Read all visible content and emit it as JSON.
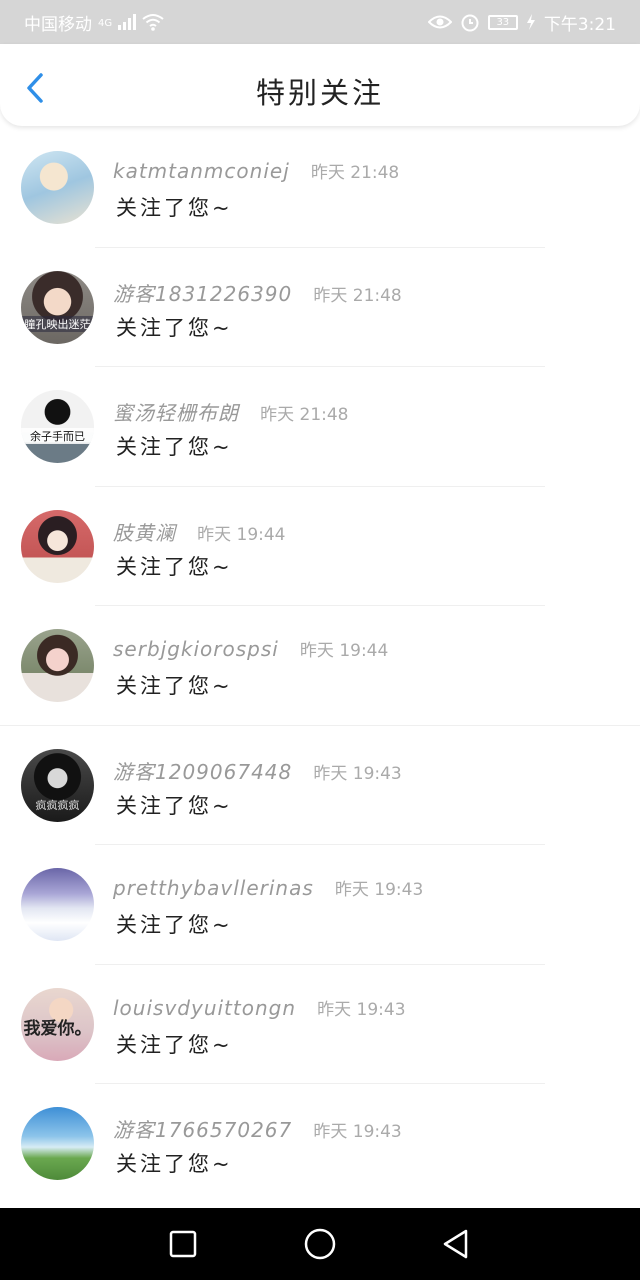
{
  "status_bar": {
    "carrier": "中国移动",
    "network": "4G",
    "time": "下午3:21",
    "battery": "33"
  },
  "header": {
    "title": "特别关注"
  },
  "notifications": [
    {
      "username": "katmtanmconiej",
      "time": "昨天 21:48",
      "message": "关注了您~",
      "avatar_caption": ""
    },
    {
      "username": "游客1831226390",
      "time": "昨天 21:48",
      "message": "关注了您~",
      "avatar_caption": "瞳孔映出迷茫"
    },
    {
      "username": "蜜汤轻栅布朗",
      "time": "昨天 21:48",
      "message": "关注了您~",
      "avatar_caption": "余子手而已"
    },
    {
      "username": "肢黄澜",
      "time": "昨天 19:44",
      "message": "关注了您~",
      "avatar_caption": ""
    },
    {
      "username": "serbjgkiorospsi",
      "time": "昨天 19:44",
      "message": "关注了您~",
      "avatar_caption": ""
    },
    {
      "username": "游客1209067448",
      "time": "昨天 19:43",
      "message": "关注了您~",
      "avatar_caption": "疯疯疯疯"
    },
    {
      "username": "pretthybavllerinas",
      "time": "昨天 19:43",
      "message": "关注了您~",
      "avatar_caption": ""
    },
    {
      "username": "louisvdyuittongn",
      "time": "昨天 19:43",
      "message": "关注了您~",
      "avatar_caption": "我爱你。"
    },
    {
      "username": "游客1766570267",
      "time": "昨天 19:43",
      "message": "关注了您~",
      "avatar_caption": ""
    }
  ],
  "colors": {
    "accent": "#2f8fe8",
    "status_bar_bg": "#d6d6d6",
    "username": "#999999",
    "message": "#222222"
  },
  "icons": {
    "back": "chevron-left-icon",
    "recent_apps": "square-icon",
    "home": "circle-icon",
    "back_system": "triangle-left-icon"
  }
}
